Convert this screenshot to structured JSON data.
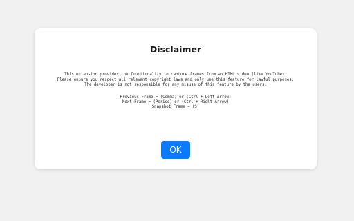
{
  "dialog": {
    "title": "Disclaimer",
    "body_lines": [
      "This extension provides the functionality to capture frames from an HTML video (like YouTube).",
      "Please ensure you respect all relevant copyright laws and only use this feature for lawful purposes.",
      "The developer is not responsible for any misuse of this feature by the users."
    ],
    "shortcuts": [
      "Previous Frame = (Comma) or (Ctrl + Left Arrow)",
      "Next Frame = (Period) or (Ctrl + Right Arrow)",
      "Snapshot Frame = (S)"
    ],
    "ok_label": "OK"
  },
  "colors": {
    "page_background": "#f1f1f1",
    "dialog_background": "#ffffff",
    "button_background": "#0a7aff",
    "button_text": "#ffffff"
  }
}
